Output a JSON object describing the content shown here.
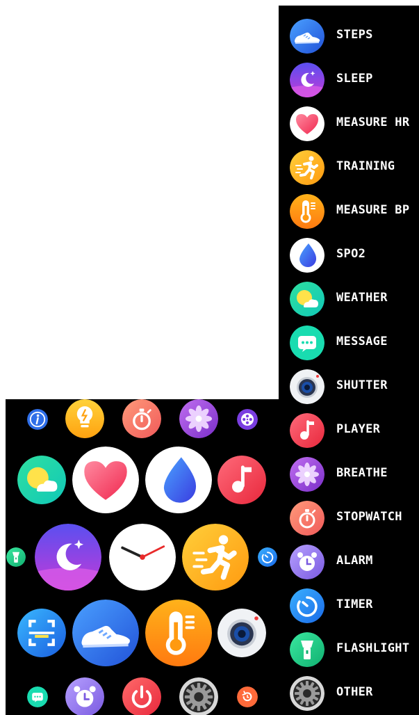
{
  "menu": {
    "items": [
      {
        "label": "STEPS",
        "icon": "sneaker-icon"
      },
      {
        "label": "SLEEP",
        "icon": "moon-icon"
      },
      {
        "label": "MEASURE HR",
        "icon": "heart-icon"
      },
      {
        "label": "TRAINING",
        "icon": "runner-icon"
      },
      {
        "label": "MEASURE BP",
        "icon": "thermometer-icon"
      },
      {
        "label": "SPO2",
        "icon": "drop-icon"
      },
      {
        "label": "WEATHER",
        "icon": "sun-cloud-icon"
      },
      {
        "label": "MESSAGE",
        "icon": "chat-bubble-icon"
      },
      {
        "label": "SHUTTER",
        "icon": "camera-icon"
      },
      {
        "label": "PLAYER",
        "icon": "music-note-icon"
      },
      {
        "label": "BREATHE",
        "icon": "flower-icon"
      },
      {
        "label": "STOPWATCH",
        "icon": "stopwatch-icon"
      },
      {
        "label": "ALARM",
        "icon": "alarm-clock-icon"
      },
      {
        "label": "TIMER",
        "icon": "timer-icon"
      },
      {
        "label": "FLASHLIGHT",
        "icon": "flashlight-icon"
      },
      {
        "label": "OTHER",
        "icon": "gear-icon"
      }
    ]
  },
  "colors": {
    "menu_bg": "#000000",
    "label": "#ffffff",
    "steps": "#2f6fe8",
    "sleep": "#8a3ee0",
    "heart": "#ff4f73",
    "training": "#ffb31a",
    "bp": "#ff9a1a",
    "spo2": "#3a6cf0",
    "weather": "#15d6a8",
    "message": "#19dcb0",
    "player": "#f0405a",
    "breathe": "#a44bdc",
    "stopwatch": "#ff7a6a",
    "alarm": "#9a7be8",
    "timer": "#1a8cf0",
    "flashlight": "#17d48a",
    "other": "#bfbfbf"
  }
}
